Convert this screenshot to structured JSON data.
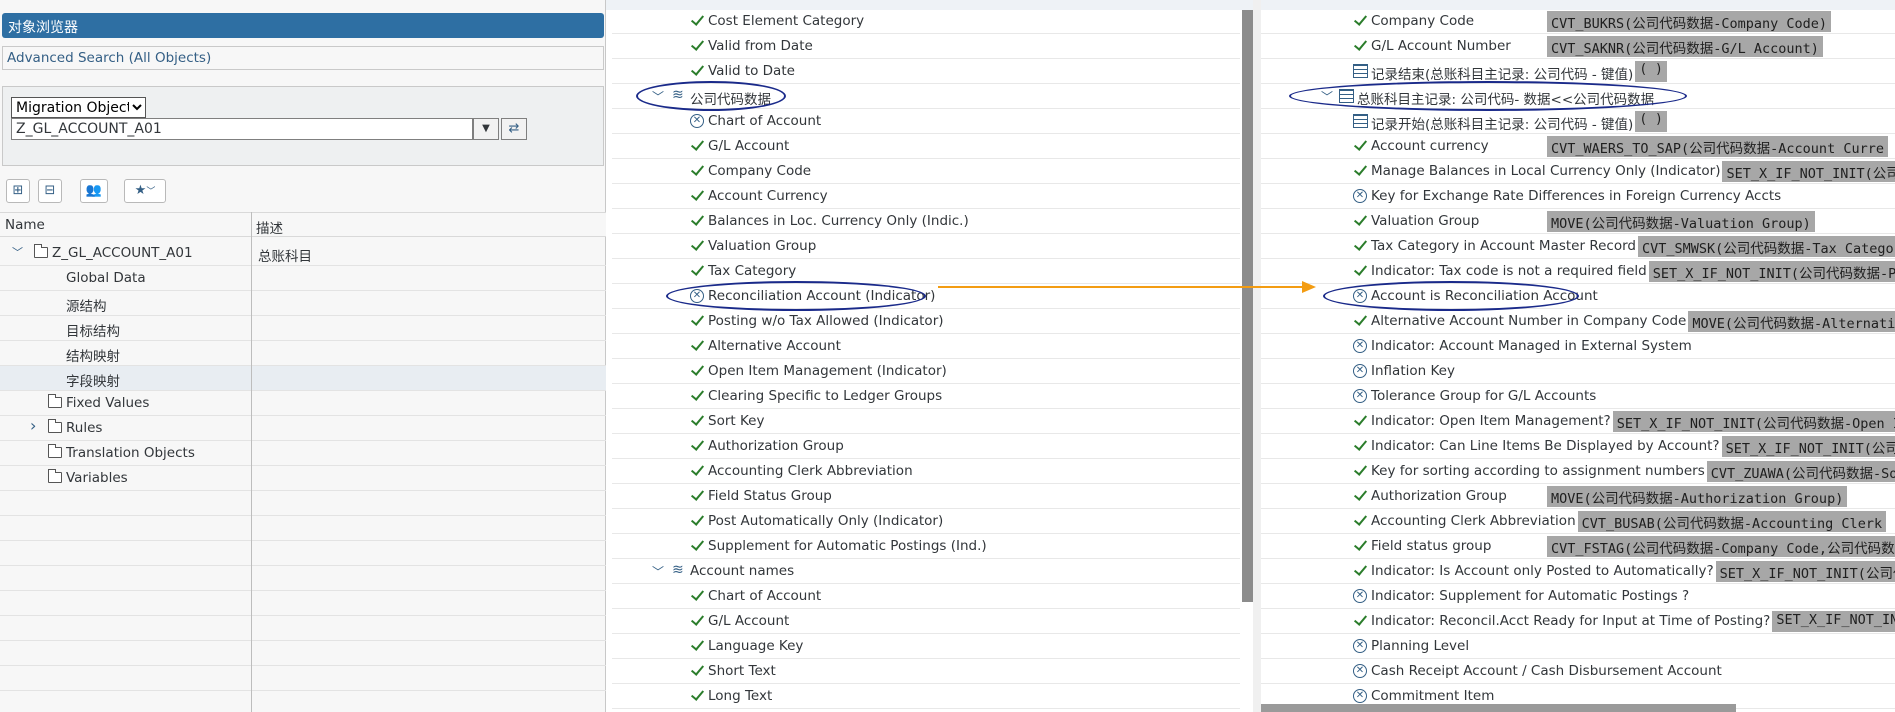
{
  "left_panel": {
    "title": "对象浏览器",
    "advanced_search": "Advanced Search (All Objects)",
    "migration_select": "Migration Object",
    "object_input": "Z_GL_ACCOUNT_A01",
    "columns": {
      "name": "Name",
      "description": "描述"
    },
    "tree": [
      {
        "label": "Z_GL_ACCOUNT_A01",
        "desc": "总账科目",
        "level": 0,
        "toggle": "expanded",
        "icon": "object"
      },
      {
        "label": "Global Data",
        "desc": "",
        "level": 2
      },
      {
        "label": "源结构",
        "desc": "",
        "level": 2
      },
      {
        "label": "目标结构",
        "desc": "",
        "level": 2
      },
      {
        "label": "结构映射",
        "desc": "",
        "level": 2
      },
      {
        "label": "字段映射",
        "desc": "",
        "level": 2,
        "selected": true
      },
      {
        "label": "Fixed Values",
        "desc": "",
        "level": 1,
        "icon": "folder"
      },
      {
        "label": "Rules",
        "desc": "",
        "level": 1,
        "icon": "folder",
        "toggle": "collapsed"
      },
      {
        "label": "Translation Objects",
        "desc": "",
        "level": 1,
        "icon": "folder"
      },
      {
        "label": "Variables",
        "desc": "",
        "level": 1,
        "icon": "folder"
      }
    ]
  },
  "source_fields": [
    {
      "label": "Cost Element Category",
      "status": "check"
    },
    {
      "label": "Valid from Date",
      "status": "check"
    },
    {
      "label": "Valid to Date",
      "status": "check"
    },
    {
      "label": "公司代码数据",
      "status": "group",
      "circled": true
    },
    {
      "label": "Chart of Account",
      "status": "x"
    },
    {
      "label": "G/L Account",
      "status": "check"
    },
    {
      "label": "Company Code",
      "status": "check"
    },
    {
      "label": "Account Currency",
      "status": "check"
    },
    {
      "label": "Balances in Loc. Currency Only (Indic.)",
      "status": "check"
    },
    {
      "label": "Valuation Group",
      "status": "check"
    },
    {
      "label": "Tax Category",
      "status": "check"
    },
    {
      "label": "Reconciliation Account (Indicator)",
      "status": "x",
      "circled": true
    },
    {
      "label": "Posting w/o Tax Allowed (Indicator)",
      "status": "check"
    },
    {
      "label": "Alternative Account",
      "status": "check"
    },
    {
      "label": "Open Item Management (Indicator)",
      "status": "check"
    },
    {
      "label": "Clearing Specific to Ledger Groups",
      "status": "check"
    },
    {
      "label": "Sort Key",
      "status": "check"
    },
    {
      "label": "Authorization Group",
      "status": "check"
    },
    {
      "label": "Accounting Clerk Abbreviation",
      "status": "check"
    },
    {
      "label": "Field Status Group",
      "status": "check"
    },
    {
      "label": "Post Automatically Only (Indicator)",
      "status": "check"
    },
    {
      "label": "Supplement for Automatic Postings (Ind.)",
      "status": "check"
    },
    {
      "label": "Account names",
      "status": "group"
    },
    {
      "label": "Chart of Account",
      "status": "check"
    },
    {
      "label": "G/L Account",
      "status": "check"
    },
    {
      "label": "Language Key",
      "status": "check"
    },
    {
      "label": "Short Text",
      "status": "check"
    },
    {
      "label": "Long Text",
      "status": "check"
    }
  ],
  "target_fields": [
    {
      "label": "Company Code",
      "status": "check",
      "rule": "CVT_BUKRS(公司代码数据-Company Code)"
    },
    {
      "label": "G/L Account Number",
      "status": "check",
      "rule": "CVT_SAKNR(公司代码数据-G/L Account)"
    },
    {
      "label": "记录结束(总账科目主记录: 公司代码 - 键值)",
      "status": "record",
      "rule": "( )"
    },
    {
      "label": "总账科目主记录: 公司代码- 数据<<公司代码数据",
      "status": "table",
      "circled": true
    },
    {
      "label": "记录开始(总账科目主记录: 公司代码 - 键值)",
      "status": "record",
      "rule": "( )"
    },
    {
      "label": "Account currency",
      "status": "check",
      "rule": "CVT_WAERS_TO_SAP(公司代码数据-Account Curre"
    },
    {
      "label": "Manage Balances in Local Currency Only (Indicator)",
      "status": "check",
      "rule": "SET_X_IF_NOT_INIT(公司代码"
    },
    {
      "label": "Key for Exchange Rate Differences in Foreign Currency Accts",
      "status": "x"
    },
    {
      "label": "Valuation Group",
      "status": "check",
      "rule": "MOVE(公司代码数据-Valuation Group)"
    },
    {
      "label": "Tax Category in Account Master Record",
      "status": "check",
      "rule": "CVT_SMWSK(公司代码数据-Tax Category"
    },
    {
      "label": "Indicator: Tax code is not a required field",
      "status": "check",
      "rule": "SET_X_IF_NOT_INIT(公司代码数据-Pos"
    },
    {
      "label": "Account is Reconciliation Account",
      "status": "x",
      "circled": true
    },
    {
      "label": "Alternative Account Number in Company Code",
      "status": "check",
      "rule": "MOVE(公司代码数据-Alternative"
    },
    {
      "label": "Indicator: Account Managed in External System",
      "status": "x"
    },
    {
      "label": "Inflation Key",
      "status": "x"
    },
    {
      "label": "Tolerance Group for G/L Accounts",
      "status": "x"
    },
    {
      "label": "Indicator: Open Item Management?",
      "status": "check",
      "rule": "SET_X_IF_NOT_INIT(公司代码数据-Open It"
    },
    {
      "label": "Indicator: Can Line Items Be Displayed by Account?",
      "status": "check",
      "rule": "SET_X_IF_NOT_INIT(公司代码"
    },
    {
      "label": "Key for sorting according to assignment numbers",
      "status": "check",
      "rule": "CVT_ZUAWA(公司代码数据-Sort"
    },
    {
      "label": "Authorization Group",
      "status": "check",
      "rule": "MOVE(公司代码数据-Authorization Group)"
    },
    {
      "label": "Accounting Clerk Abbreviation",
      "status": "check",
      "rule": "CVT_BUSAB(公司代码数据-Accounting Clerk"
    },
    {
      "label": "Field status group",
      "status": "check",
      "rule": "CVT_FSTAG(公司代码数据-Company Code,公司代码数"
    },
    {
      "label": "Indicator: Is Account only Posted to Automatically?",
      "status": "check",
      "rule": "SET_X_IF_NOT_INIT(公司代码"
    },
    {
      "label": "Indicator: Supplement for Automatic Postings ?",
      "status": "x"
    },
    {
      "label": "Indicator: Reconcil.Acct Ready for Input at Time of Posting?",
      "status": "check",
      "rule": "SET_X_IF_NOT_INIT("
    },
    {
      "label": "Planning Level",
      "status": "x"
    },
    {
      "label": "Cash Receipt Account / Cash Disbursement Account",
      "status": "x"
    },
    {
      "label": "Commitment Item",
      "status": "x"
    }
  ],
  "colors": {
    "accent": "#2e6fa3",
    "check": "#2b7d2b",
    "annotation": "#1a2a8a",
    "arrow": "#f39c12",
    "rule_bg": "#a7a7a7"
  },
  "icons": {
    "check": "check-icon",
    "x": "x-circle-icon",
    "group": "structure-icon",
    "table": "table-icon",
    "record": "record-icon"
  }
}
